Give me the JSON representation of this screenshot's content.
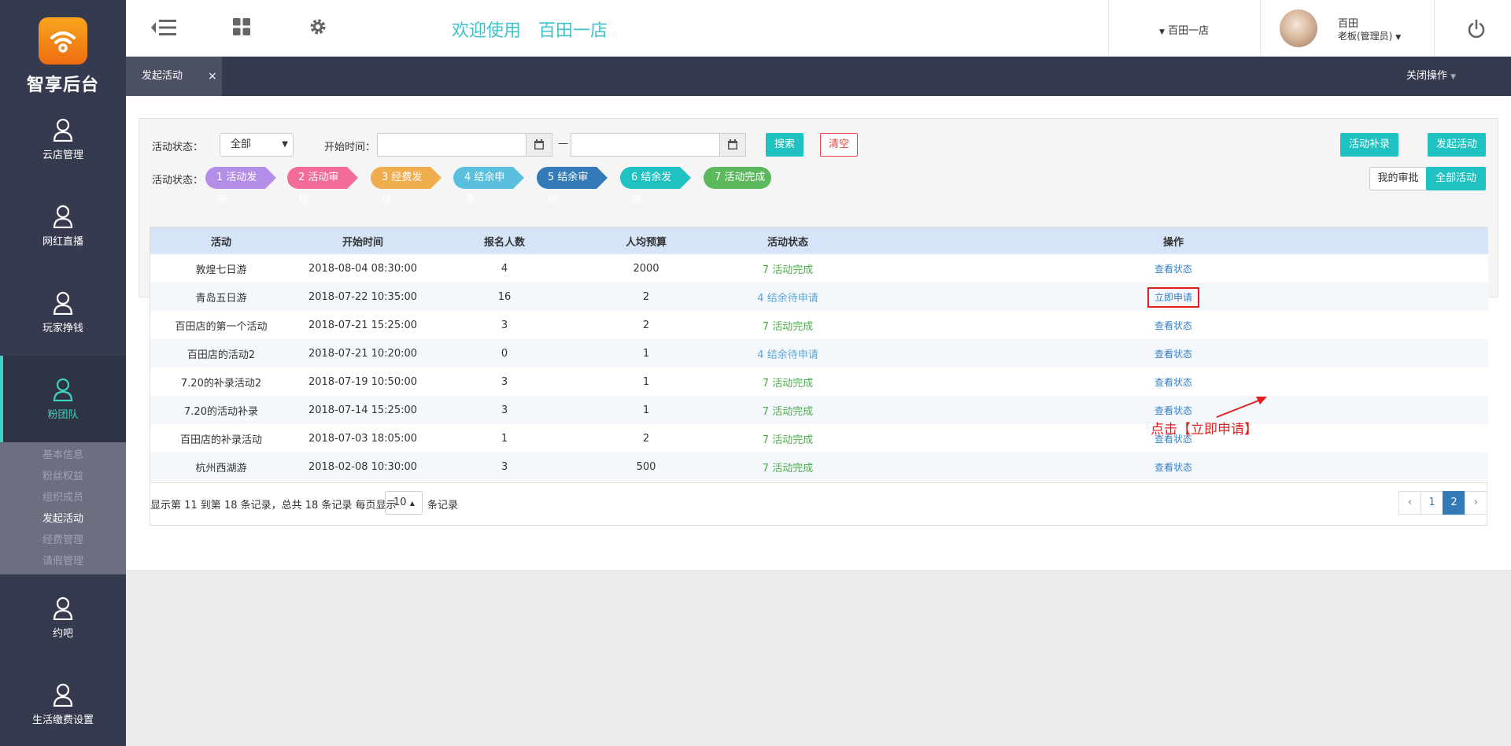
{
  "brand": {
    "name": "智享后台",
    "logo_color": "#f08a1c"
  },
  "sidebar": {
    "items": [
      {
        "label": "云店管理",
        "icon": "user-icon"
      },
      {
        "label": "网红直播",
        "icon": "user-icon"
      },
      {
        "label": "玩家挣钱",
        "icon": "user-icon"
      },
      {
        "label": "粉团队",
        "icon": "user-icon",
        "active": true
      },
      {
        "label": "约吧",
        "icon": "user-icon"
      },
      {
        "label": "生活缴费设置",
        "icon": "user-icon"
      }
    ],
    "sub_items": [
      "基本信息",
      "粉丝权益",
      "组织成员",
      "发起活动",
      "经费管理",
      "请假管理"
    ],
    "active_sub": "发起活动"
  },
  "header": {
    "welcome": "欢迎使用",
    "store_name": "百田一店",
    "store_select": "百田一店",
    "user_name": "百田",
    "user_role": "老板(管理员)"
  },
  "tabs": {
    "active_label": "发起活动",
    "close": "×",
    "close_ops": "关闭操作"
  },
  "filter": {
    "status_label": "活动状态：",
    "status_value": "全部",
    "start_time_label": "开始时间：",
    "dash": "—",
    "search_label": "搜索",
    "clear_label": "清空",
    "supplement_label": "活动补录",
    "launch_label": "发起活动",
    "steps_label": "活动状态：",
    "steps": [
      {
        "label": "1 活动发布",
        "color": "#b28ee6"
      },
      {
        "label": "2 活动审核",
        "color": "#f36b9b"
      },
      {
        "label": "3 经费发放",
        "color": "#f0ad4e"
      },
      {
        "label": "4 结余申请",
        "color": "#5bc0de"
      },
      {
        "label": "5 结余审核",
        "color": "#337ab7"
      },
      {
        "label": "6 结余发放",
        "color": "#1fc1c1"
      },
      {
        "label": "7 活动完成",
        "color": "#5cb85c"
      }
    ],
    "my_approval": "我的审批",
    "all_activities": "全部活动"
  },
  "table": {
    "headers": [
      "活动",
      "开始时间",
      "报名人数",
      "人均预算",
      "活动状态",
      "操作"
    ],
    "rows": [
      {
        "name": "敦煌七日游",
        "start": "2018-08-04 08:30:00",
        "count": "4",
        "budget": "2000",
        "status": "7 活动完成",
        "status_type": "complete",
        "op": "查看状态"
      },
      {
        "name": "青岛五日游",
        "start": "2018-07-22 10:35:00",
        "count": "16",
        "budget": "2",
        "status": "4 结余待申请",
        "status_type": "pending",
        "op": "立即申请",
        "highlight": true
      },
      {
        "name": "百田店的第一个活动",
        "start": "2018-07-21 15:25:00",
        "count": "3",
        "budget": "2",
        "status": "7 活动完成",
        "status_type": "complete",
        "op": "查看状态"
      },
      {
        "name": "百田店的活动2",
        "start": "2018-07-21 10:20:00",
        "count": "0",
        "budget": "1",
        "status": "4 结余待申请",
        "status_type": "pending",
        "op": "查看状态"
      },
      {
        "name": "7.20的补录活动2",
        "start": "2018-07-19 10:50:00",
        "count": "3",
        "budget": "1",
        "status": "7 活动完成",
        "status_type": "complete",
        "op": "查看状态"
      },
      {
        "name": "7.20的活动补录",
        "start": "2018-07-14 15:25:00",
        "count": "3",
        "budget": "1",
        "status": "7 活动完成",
        "status_type": "complete",
        "op": "查看状态"
      },
      {
        "name": "百田店的补录活动",
        "start": "2018-07-03 18:05:00",
        "count": "1",
        "budget": "2",
        "status": "7 活动完成",
        "status_type": "complete",
        "op": "查看状态"
      },
      {
        "name": "杭州西湖游",
        "start": "2018-02-08 10:30:00",
        "count": "3",
        "budget": "500",
        "status": "7 活动完成",
        "status_type": "complete",
        "op": "查看状态"
      }
    ]
  },
  "pagination": {
    "info": "显示第 11 到第 18 条记录，总共 18 条记录 每页显示",
    "page_size": "10",
    "suffix": "条记录",
    "prev": "‹",
    "pages": [
      "1",
      "2"
    ],
    "active_page": "2",
    "next": "›"
  },
  "annotation": "点击【立即申请】",
  "colors": {
    "sidebar_bg": "#353a4e",
    "accent": "#1fc1c1",
    "welcome": "#3fc1c9",
    "annotation": "#e21f1f"
  }
}
